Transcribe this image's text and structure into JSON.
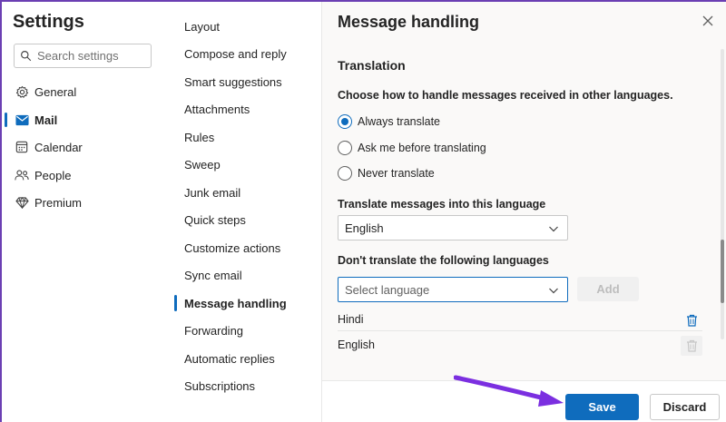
{
  "settings": {
    "title": "Settings",
    "search_placeholder": "Search settings",
    "nav": [
      {
        "label": "General",
        "icon": "gear-icon"
      },
      {
        "label": "Mail",
        "icon": "mail-icon",
        "active": true
      },
      {
        "label": "Calendar",
        "icon": "calendar-icon"
      },
      {
        "label": "People",
        "icon": "people-icon"
      },
      {
        "label": "Premium",
        "icon": "diamond-icon"
      }
    ]
  },
  "mail_nav": {
    "items": [
      {
        "label": "Layout"
      },
      {
        "label": "Compose and reply"
      },
      {
        "label": "Smart suggestions"
      },
      {
        "label": "Attachments"
      },
      {
        "label": "Rules"
      },
      {
        "label": "Sweep"
      },
      {
        "label": "Junk email"
      },
      {
        "label": "Quick steps"
      },
      {
        "label": "Customize actions"
      },
      {
        "label": "Sync email"
      },
      {
        "label": "Message handling",
        "active": true
      },
      {
        "label": "Forwarding"
      },
      {
        "label": "Automatic replies"
      },
      {
        "label": "Subscriptions"
      }
    ]
  },
  "panel": {
    "title": "Message handling",
    "section_title": "Translation",
    "question": "Choose how to handle messages received in other languages.",
    "options": [
      {
        "label": "Always translate",
        "checked": true
      },
      {
        "label": "Ask me before translating",
        "checked": false
      },
      {
        "label": "Never translate",
        "checked": false
      }
    ],
    "translate_into_label": "Translate messages into this language",
    "translate_into_value": "English",
    "dont_translate_label": "Don't translate the following languages",
    "select_language_placeholder": "Select language",
    "add_label": "Add",
    "languages": [
      "Hindi",
      "English"
    ]
  },
  "footer": {
    "save_label": "Save",
    "discard_label": "Discard"
  },
  "colors": {
    "accent": "#0f6cbd",
    "annotation_arrow": "#7b2fe0"
  }
}
